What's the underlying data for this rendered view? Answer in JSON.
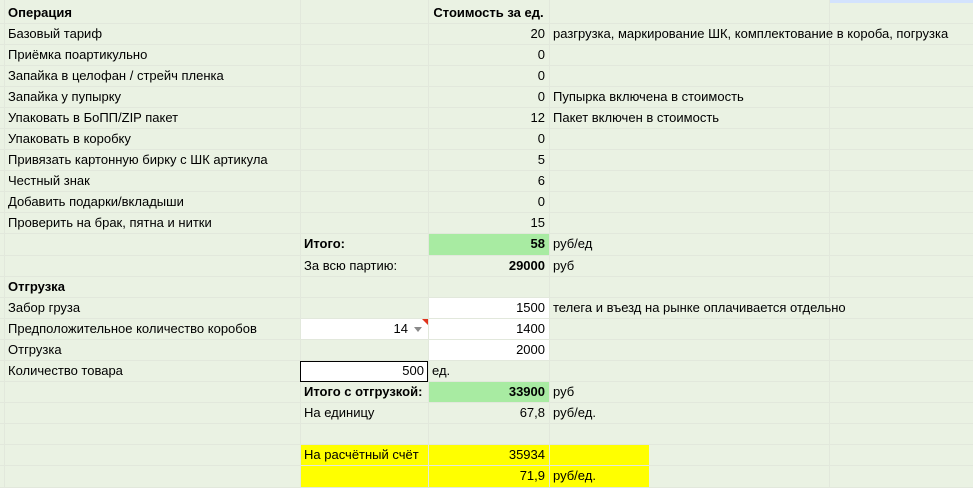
{
  "colors": {
    "row_bg": "#eaf2e3",
    "white": "#ffffff",
    "grid": "#e2e8dc",
    "green": "#a8eba2",
    "yellow": "#ffff00",
    "border_box": "#000000",
    "header_band": "#d3e3fd"
  },
  "header": {
    "col1": "Операция",
    "col3": "Стоимость за ед."
  },
  "operations": [
    {
      "name": "Базовый тариф",
      "value": "20",
      "note": "разгрузка, маркирование ШК, комплектование в короба, погрузка"
    },
    {
      "name": "Приёмка поартикульно",
      "value": "0",
      "note": ""
    },
    {
      "name": "Запайка в целофан / стрейч пленка",
      "value": "0",
      "note": ""
    },
    {
      "name": "Запайка у пупырку",
      "value": "0",
      "note": "Пупырка включена в стоимость"
    },
    {
      "name": "Упаковать в БоПП/ZIP пакет",
      "value": "12",
      "note": "Пакет включен в стоимость"
    },
    {
      "name": "Упаковать в коробку",
      "value": "0",
      "note": ""
    },
    {
      "name": "Привязать картонную бирку с ШК артикула",
      "value": "5",
      "note": ""
    },
    {
      "name": "Честный знак",
      "value": "6",
      "note": ""
    },
    {
      "name": "Добавить подарки/вкладыши",
      "value": "0",
      "note": ""
    },
    {
      "name": "Проверить на брак, пятна и нитки",
      "value": "15",
      "note": ""
    }
  ],
  "total": {
    "label": "Итого:",
    "value": "58",
    "unit": "руб/ед"
  },
  "batch": {
    "label": "За всю партию:",
    "value": "29000",
    "unit": "руб"
  },
  "shipping_header": "Отгрузка",
  "pickup": {
    "label": "Забор груза",
    "value": "1500",
    "note": "телега и въезд на рынке оплачивается отдельно"
  },
  "boxes": {
    "label": "Предположительное количество коробов",
    "selected": "14",
    "value": "1400"
  },
  "shipment": {
    "label": "Отгрузка",
    "value": "2000"
  },
  "quantity": {
    "label": "Количество товара",
    "value": "500",
    "unit": "ед."
  },
  "total_ship": {
    "label": "Итого с отгрузкой:",
    "value": "33900",
    "unit": "руб"
  },
  "per_unit": {
    "label": "На единицу",
    "value": "67,8",
    "unit": "руб/ед."
  },
  "account": {
    "label": "На расчётный счёт",
    "value": "35934",
    "per_unit": "71,9",
    "unit": "руб/ед."
  }
}
